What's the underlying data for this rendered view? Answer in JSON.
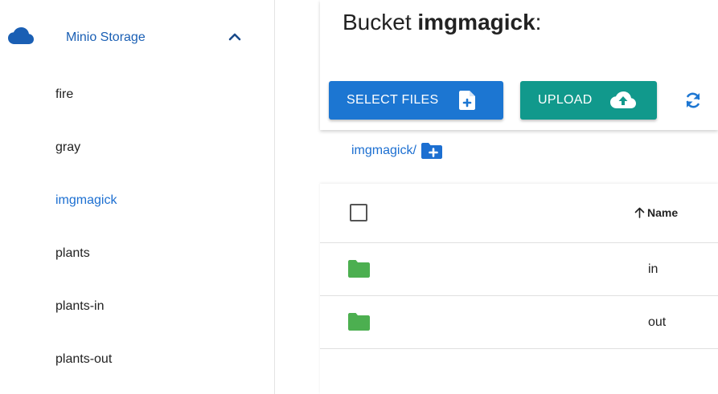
{
  "sidebar": {
    "storage_label": "Minio Storage",
    "buckets": [
      {
        "label": "fire",
        "active": false
      },
      {
        "label": "gray",
        "active": false
      },
      {
        "label": "imgmagick",
        "active": true
      },
      {
        "label": "plants",
        "active": false
      },
      {
        "label": "plants-in",
        "active": false
      },
      {
        "label": "plants-out",
        "active": false
      }
    ],
    "icons": {
      "storage": "cloud-icon",
      "toggle": "chevron-up-icon"
    }
  },
  "header": {
    "title_prefix": "Bucket ",
    "bucket_name": "imgmagick",
    "title_suffix": ":"
  },
  "toolbar": {
    "select_files_label": "SELECT FILES",
    "upload_label": "UPLOAD",
    "icons": {
      "select_files": "file-plus-icon",
      "upload": "cloud-upload-icon",
      "refresh": "refresh-icon"
    }
  },
  "breadcrumb": {
    "path": "imgmagick/",
    "icon": "new-folder-icon"
  },
  "table": {
    "columns": [
      {
        "label": "Name",
        "sort": "ascending"
      }
    ],
    "rows": [
      {
        "name": "in",
        "type": "folder"
      },
      {
        "name": "out",
        "type": "folder"
      }
    ]
  },
  "colors": {
    "primary_blue": "#1c76d2",
    "link_blue": "#1c6fd1",
    "upload_teal": "#11998c",
    "folder_green": "#4caf50"
  }
}
